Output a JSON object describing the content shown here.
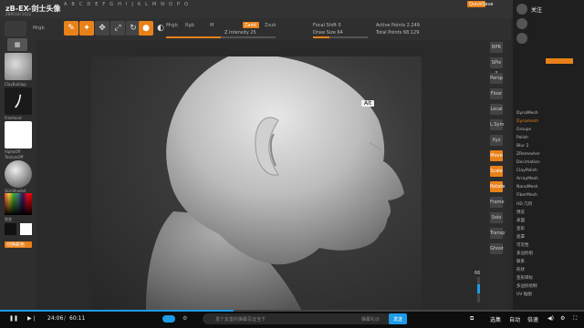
{
  "app": {
    "title": "zB-EX-剑士头像",
    "subtitle": "ZBRUSH 2022"
  },
  "menu": [
    "A",
    "B",
    "C",
    "D",
    "E",
    "F",
    "G",
    "H",
    "I",
    "J",
    "K",
    "L",
    "M",
    "N",
    "O",
    "P",
    "Q"
  ],
  "topright": {
    "label": "QuickSave",
    "accent": "#e8811a"
  },
  "toolbar": {
    "fields": [
      "Mrgb",
      "Rgb",
      "M",
      "Zadd",
      "Zsub",
      "Z Intensity 25",
      "Draw Size 64",
      "Focal Shift 0",
      "Active Points 2.249",
      "Total Points 68.129"
    ],
    "buttons": [
      "Edit",
      "Draw",
      "Move",
      "Scale",
      "Rotate",
      "Sculpt"
    ]
  },
  "left": {
    "items": [
      "ClayBuildup",
      "Freehand",
      "AlphaOff",
      "TextureOff",
      "SkinShade4"
    ],
    "labels": [
      "渐变",
      "切换颜色"
    ]
  },
  "viewport": {
    "tooltip": "Alt"
  },
  "rshelf": {
    "buttons": [
      "BPR",
      "SPix 3",
      "Persp",
      "Floor",
      "Local",
      "L.Sym",
      "Xyz",
      "Move",
      "Scale",
      "Rotate",
      "Frame",
      "Solo",
      "Transp",
      "Ghost"
    ]
  },
  "rtray": {
    "header": "关注",
    "items": [
      "DynaMesh",
      "Dynamesh",
      "Groups",
      "Polish",
      "Blur 2",
      "ZRemesher",
      "Decimation",
      "ClayPolish",
      "ArrayMesh",
      "NanoMesh",
      "FiberMesh",
      "HD 几何",
      "预览",
      "表面",
      "变形",
      "遮罩",
      "可见性",
      "多边形组",
      "联系",
      "形状",
      "变形目标",
      "多边形绘制",
      "UV 贴图"
    ]
  },
  "player": {
    "time_current": "24:06",
    "time_total": "60:11",
    "danmaku_placeholder": "发个友善的弹幕见证当下",
    "danmaku_hint": "弹幕礼仪",
    "send_label": "发送",
    "right_labels": [
      "选集",
      "自动",
      "倍速"
    ],
    "progress_pct": 40
  }
}
